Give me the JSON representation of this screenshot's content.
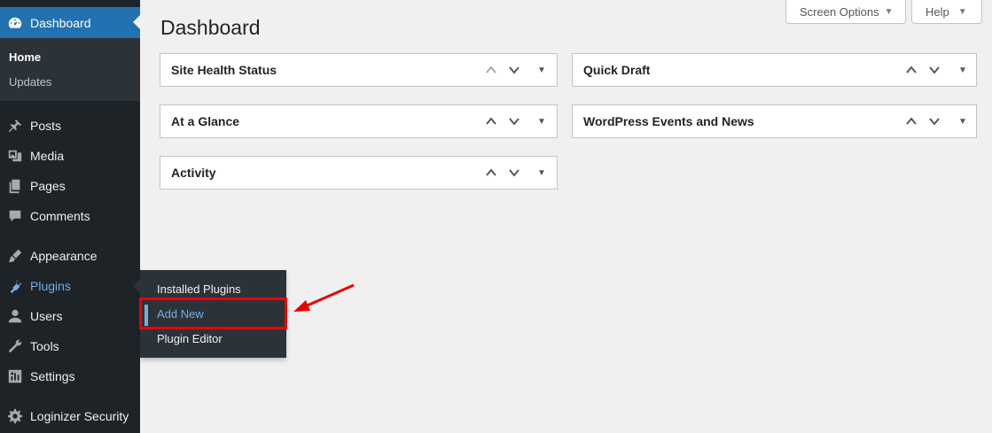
{
  "sidebar": {
    "dashboard_label": "Dashboard",
    "submenu": [
      "Home",
      "Updates"
    ],
    "items": [
      {
        "label": "Posts",
        "icon": "pin-icon"
      },
      {
        "label": "Media",
        "icon": "media-icon"
      },
      {
        "label": "Pages",
        "icon": "pages-icon"
      },
      {
        "label": "Comments",
        "icon": "comment-icon"
      },
      {
        "label": "Appearance",
        "icon": "brush-icon"
      },
      {
        "label": "Plugins",
        "icon": "plugin-icon"
      },
      {
        "label": "Users",
        "icon": "user-icon"
      },
      {
        "label": "Tools",
        "icon": "wrench-icon"
      },
      {
        "label": "Settings",
        "icon": "settings-icon"
      },
      {
        "label": "Loginizer Security",
        "icon": "gear-icon"
      }
    ]
  },
  "flyout": {
    "items": [
      "Installed Plugins",
      "Add New",
      "Plugin Editor"
    ]
  },
  "header": {
    "title": "Dashboard",
    "screen_options": "Screen Options",
    "help": "Help"
  },
  "widgets": {
    "left": [
      "Site Health Status",
      "At a Glance",
      "Activity"
    ],
    "right": [
      "Quick Draft",
      "WordPress Events and News"
    ]
  },
  "colors": {
    "sidebar": "#1d2327",
    "accent": "#2271b1",
    "highlight": "#72aee6",
    "annotation": "#e00000"
  }
}
